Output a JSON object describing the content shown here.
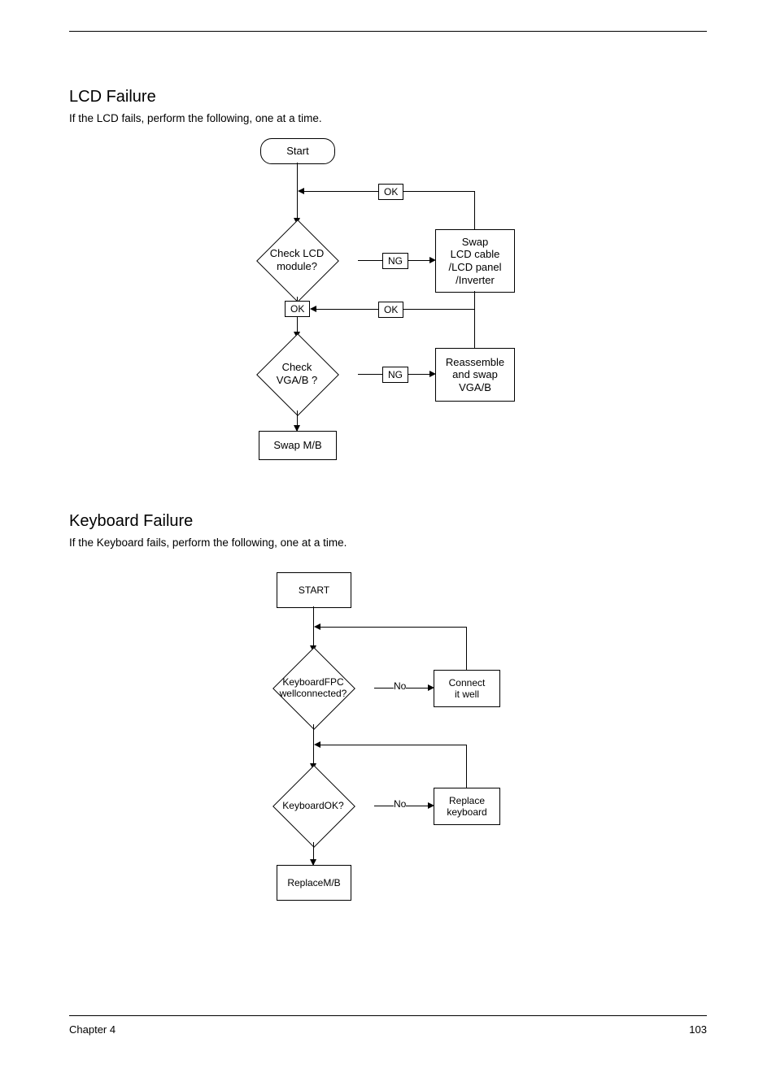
{
  "headings": {
    "h1": "LCD Failure",
    "sub1": "If the LCD fails, perform the following, one at a time.",
    "h2": "Keyboard Failure",
    "sub2": "If the Keyboard fails, perform the following, one at a time."
  },
  "flow1": {
    "start": "Start",
    "d1_l1": "Check LCD",
    "d1_l2": "module?",
    "d2_l1": "Check",
    "d2_l2": "VGA/B ?",
    "box1_l1": "Swap",
    "box1_l2": "LCD cable",
    "box1_l3": "/LCD panel",
    "box1_l4": "/Inverter",
    "box2_l1": "Reassemble",
    "box2_l2": "and swap",
    "box2_l3": "VGA/B",
    "swap": "Swap M/B",
    "ok": "OK",
    "ng": "NG"
  },
  "flow2": {
    "start": "START",
    "d1_l1": "KeyboardFPC",
    "d1_l2": "wellconnected?",
    "d2": "KeyboardOK?",
    "box1_l1": "Connect",
    "box1_l2": "it well",
    "box2_l1": "Replace",
    "box2_l2": "keyboard",
    "replace": "ReplaceM/B",
    "no": "No"
  },
  "footer": {
    "left": "Chapter 4",
    "right": "103"
  }
}
